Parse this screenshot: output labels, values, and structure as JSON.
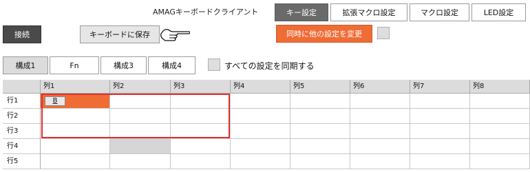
{
  "app_title": "AMAGキーボードクライアント",
  "tabs": [
    {
      "label": "キー設定",
      "active": true
    },
    {
      "label": "拡張マクロ設定",
      "active": false
    },
    {
      "label": "マクロ設定",
      "active": false
    },
    {
      "label": "LED設定",
      "active": false
    }
  ],
  "toolbar": {
    "connect_label": "接続",
    "save_label": "キーボードに保存",
    "change_other_label": "同時に他の設定を変更"
  },
  "config_tabs": [
    {
      "label": "構成1",
      "active": true
    },
    {
      "label": "Fn",
      "active": false
    },
    {
      "label": "構成3",
      "active": false
    },
    {
      "label": "構成4",
      "active": false
    }
  ],
  "sync": {
    "label": "すべての設定を同期する",
    "checked": false
  },
  "grid": {
    "columns": [
      "列1",
      "列2",
      "列3",
      "列4",
      "列5",
      "列6",
      "列7",
      "列8"
    ],
    "rows": [
      "行1",
      "行2",
      "行3",
      "行4",
      "行5"
    ],
    "key_label": "B",
    "colors": {
      "accent": "#ef6c35",
      "selection": "#e0302e",
      "disabled": "#d6d6d6"
    }
  }
}
